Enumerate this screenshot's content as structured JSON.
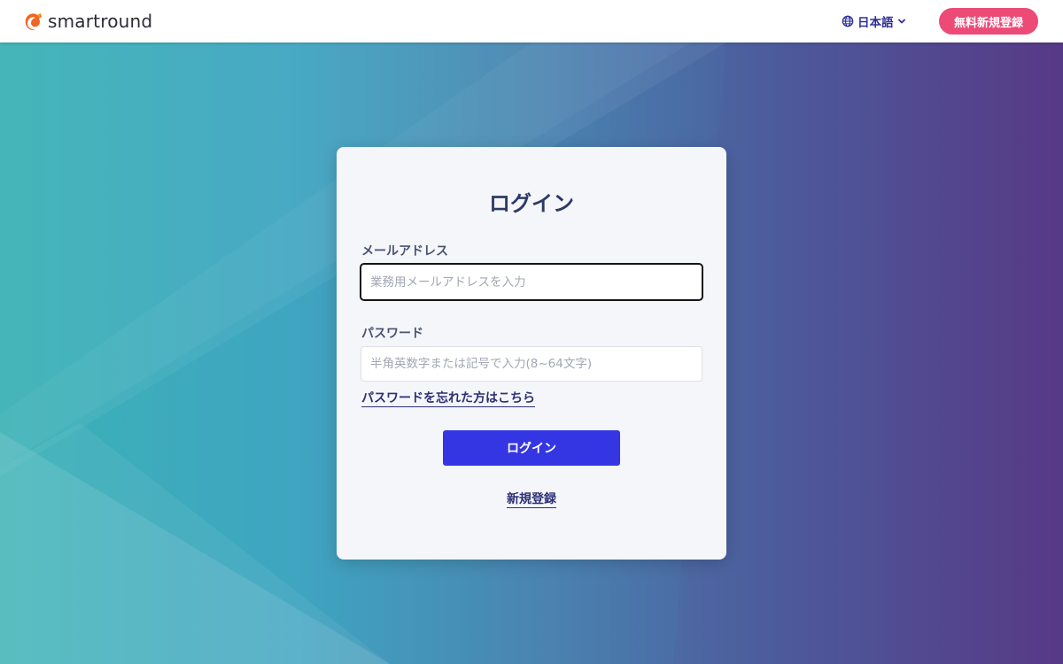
{
  "header": {
    "logo_text": "smartround",
    "logo_icon": "flame-swirl-logo",
    "language_label": "日本語",
    "language_icon": "globe-icon",
    "language_chevron_icon": "chevron-down-icon",
    "signup_label": "無料新規登録"
  },
  "login_form": {
    "title": "ログイン",
    "email_label": "メールアドレス",
    "email_placeholder": "業務用メールアドレスを入力",
    "email_value": "",
    "password_label": "パスワード",
    "password_placeholder": "半角英数字または記号で入力(8~64文字)",
    "password_value": "",
    "forgot_password_link": "パスワードを忘れた方はこちら",
    "submit_label": "ログイン",
    "register_link": "新規登録"
  },
  "colors": {
    "signup_button": "#ec4b77",
    "login_button": "#3435e3",
    "title_text": "#2c3a64",
    "link_text": "#2d2f77",
    "language_text": "#2f2f9a",
    "background_gradient_start": "#3bb2b6",
    "background_gradient_end": "#563a86",
    "logo_orange": "#f26522"
  }
}
